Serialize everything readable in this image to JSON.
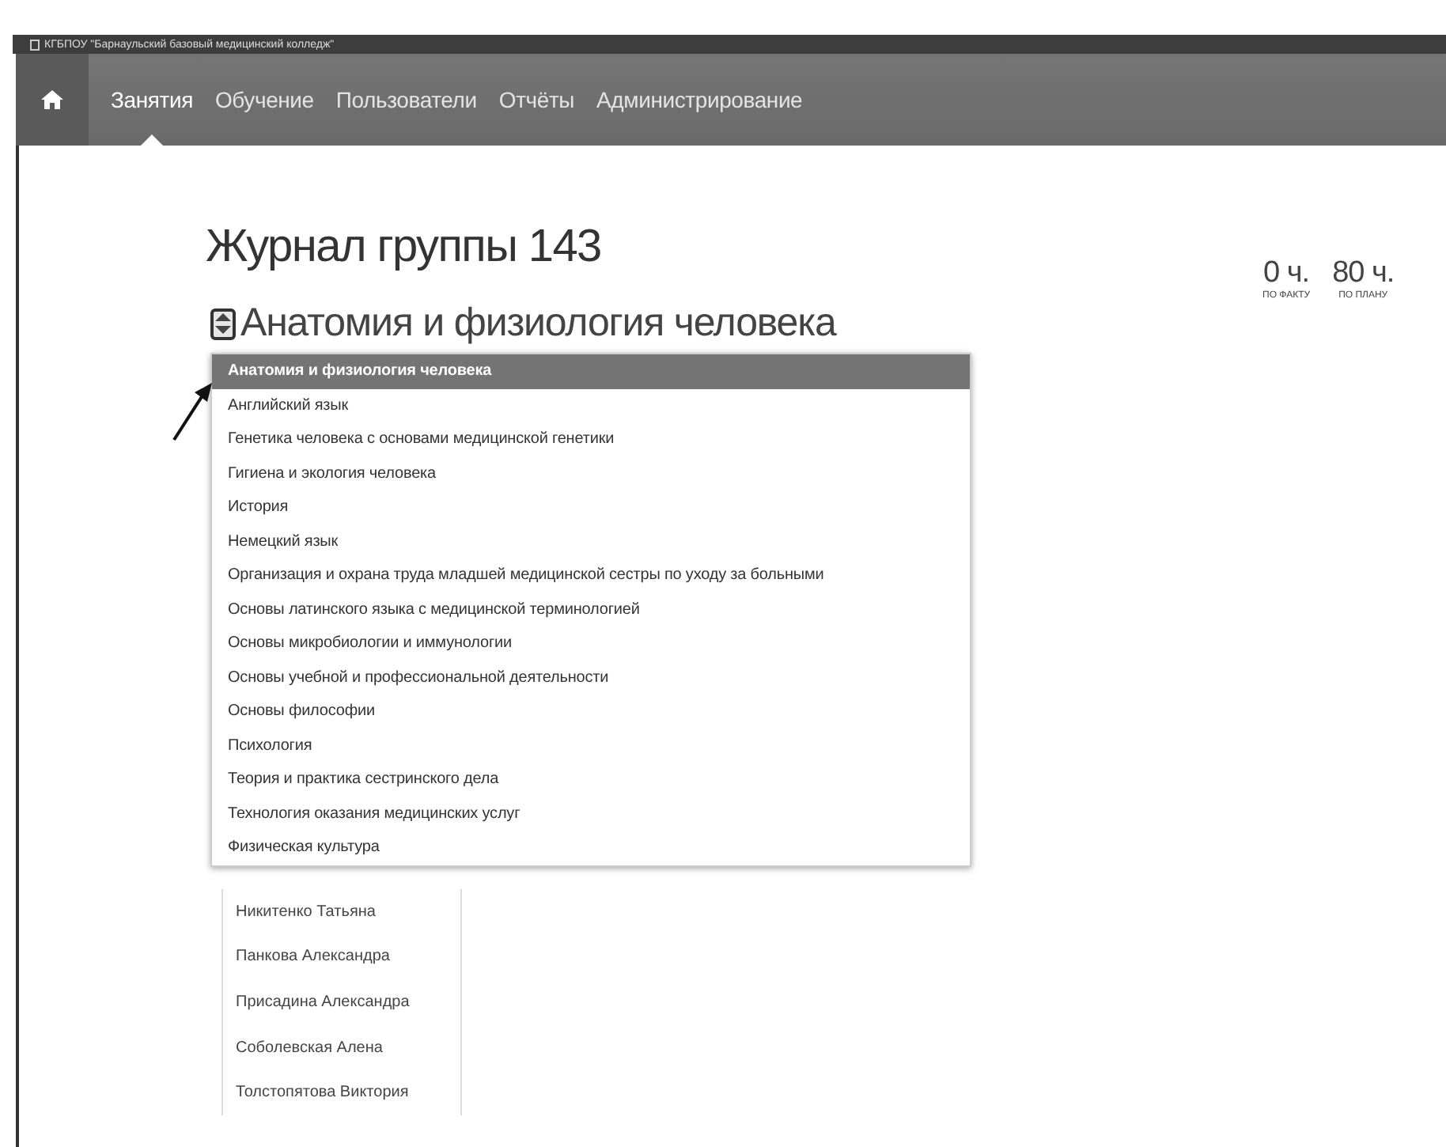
{
  "window": {
    "title": "КГБПОУ \"Барнаульский базовый медицинский колледж\""
  },
  "nav": {
    "items": [
      {
        "label": "Занятия",
        "selected": true
      },
      {
        "label": "Обучение",
        "selected": false
      },
      {
        "label": "Пользователи",
        "selected": false
      },
      {
        "label": "Отчёты",
        "selected": false
      },
      {
        "label": "Администрирование",
        "selected": false
      }
    ]
  },
  "page_title": "Журнал группы 143",
  "subject_select": {
    "value": "Анатомия и физиология человека",
    "expanded": true
  },
  "hours": [
    {
      "value": "0 ч.",
      "caption": "ПО ФАКТУ"
    },
    {
      "value": "80 ч.",
      "caption": "ПО ПЛАНУ"
    }
  ],
  "dropdown": {
    "options": [
      {
        "label": "Анатомия и физиология человека",
        "selected": true
      },
      {
        "label": "Английский язык",
        "selected": false
      },
      {
        "label": "Генетика человека с основами медицинской генетики",
        "selected": false
      },
      {
        "label": "Гигиена и экология человека",
        "selected": false
      },
      {
        "label": "История",
        "selected": false
      },
      {
        "label": "Немецкий язык",
        "selected": false
      },
      {
        "label": "Организация и охрана труда младшей медицинской сестры по уходу за больными",
        "selected": false
      },
      {
        "label": "Основы латинского языка с медицинской терминологией",
        "selected": false
      },
      {
        "label": "Основы микробиологии и иммунологии",
        "selected": false
      },
      {
        "label": "Основы учебной и профессиональной деятельности",
        "selected": false
      },
      {
        "label": "Основы философии",
        "selected": false
      },
      {
        "label": "Психология",
        "selected": false
      },
      {
        "label": "Теория и практика сестринского дела",
        "selected": false
      },
      {
        "label": "Технология оказания медицинских услуг",
        "selected": false
      },
      {
        "label": "Физическая культура",
        "selected": false
      }
    ]
  },
  "students": [
    "Никитенко Татьяна",
    "Панкова Александра",
    "Присадина Александра",
    "Соболевская Алена",
    "Толстопятова Виктория"
  ]
}
